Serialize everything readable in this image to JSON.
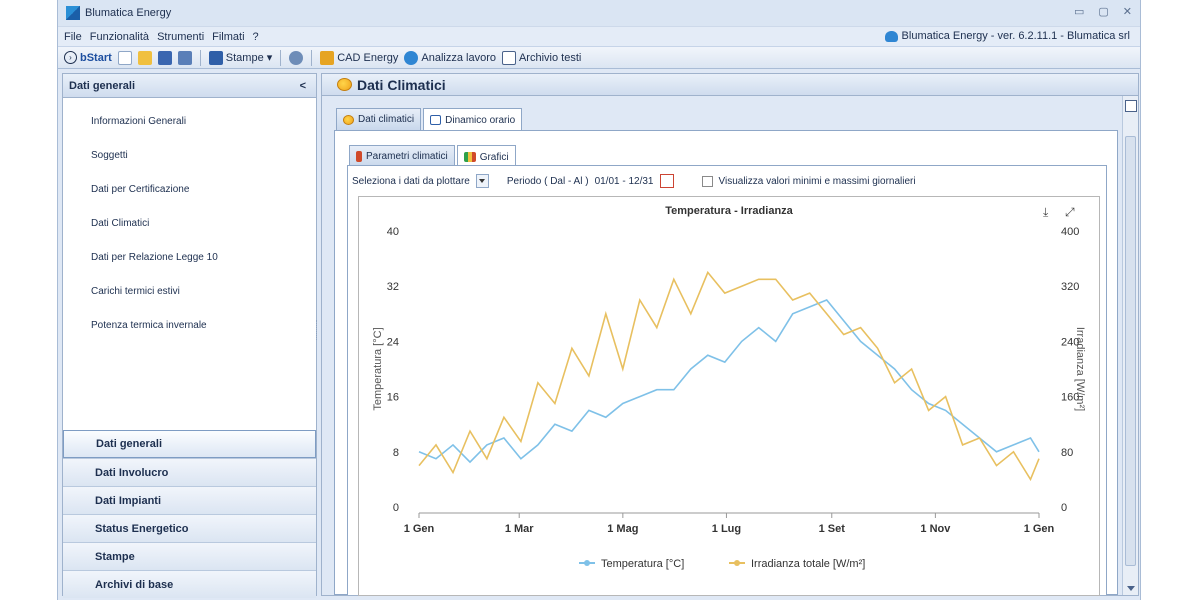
{
  "window": {
    "title": "Blumatica Energy",
    "controls": [
      "▭",
      "▢",
      "✕"
    ]
  },
  "menu": {
    "items": [
      "File",
      "Funzionalità",
      "Strumenti",
      "Filmati",
      "?"
    ],
    "version": "Blumatica Energy - ver. 6.2.11.1 - Blumatica srl"
  },
  "toolbar": {
    "bstart": "bStart",
    "stampe": "Stampe",
    "cad": "CAD Energy",
    "analizza": "Analizza lavoro",
    "archivio": "Archivio testi"
  },
  "left": {
    "header": "Dati generali",
    "collapse": "<",
    "items": [
      {
        "label": "Informazioni Generali",
        "color": "#2f7fd0"
      },
      {
        "label": "Soggetti",
        "color": "#c0392b"
      },
      {
        "label": "Dati per Certificazione",
        "color": "#2563b8"
      },
      {
        "label": "Dati Climatici",
        "color": "#f0a21a"
      },
      {
        "label": "Dati per Relazione Legge 10",
        "color": "#2563b8"
      },
      {
        "label": "Carichi termici estivi",
        "color": "#e0a010"
      },
      {
        "label": "Potenza termica invernale",
        "color": "#3a8fd8"
      }
    ],
    "nav": [
      {
        "label": "Dati generali",
        "color": "#6d7d93"
      },
      {
        "label": "Dati Involucro",
        "color": "#2f7fd0"
      },
      {
        "label": "Dati Impianti",
        "color": "#2f7fd0"
      },
      {
        "label": "Status Energetico",
        "color": "#2fa14a"
      },
      {
        "label": "Stampe",
        "color": "#7a8aa0"
      },
      {
        "label": "Archivi di base",
        "color": "#e0b040"
      }
    ]
  },
  "main": {
    "title": "Dati Climatici",
    "tabs": [
      "Dati climatici",
      "Dinamico orario"
    ],
    "subtabs": [
      "Parametri climatici",
      "Grafici"
    ],
    "filter": {
      "select_label": "Seleziona i dati da plottare",
      "period_label": "Periodo ( Dal - Al )",
      "period_value": "01/01 - 12/31",
      "minmax_label": "Visualizza valori minimi e massimi giornalieri"
    }
  },
  "chart_data": {
    "type": "line",
    "title": "Temperatura - Irradianza",
    "xlabel": "",
    "ylabel": "Temperatura [°C]",
    "y2label": "Irradianza [W/m²]",
    "xticks": [
      "1 Gen",
      "1 Mar",
      "1 Mag",
      "1 Lug",
      "1 Set",
      "1 Nov",
      "1 Gen"
    ],
    "xtick_days": [
      0,
      59,
      120,
      181,
      243,
      304,
      365
    ],
    "ylim": [
      0,
      40
    ],
    "yticks": [
      0,
      8,
      16,
      24,
      32,
      40
    ],
    "y2lim": [
      0,
      400
    ],
    "y2ticks": [
      0,
      80,
      160,
      240,
      320,
      400
    ],
    "legend": "bottom",
    "series": [
      {
        "name": "Temperatura [°C]",
        "axis": "left",
        "color": "#7fc1e8",
        "x": [
          0,
          10,
          20,
          30,
          40,
          50,
          60,
          70,
          80,
          90,
          100,
          110,
          120,
          130,
          140,
          150,
          160,
          170,
          180,
          190,
          200,
          210,
          220,
          230,
          240,
          250,
          260,
          270,
          280,
          290,
          300,
          310,
          320,
          330,
          340,
          350,
          360,
          365
        ],
        "values": [
          8,
          7,
          9,
          6.5,
          9,
          10,
          7,
          9,
          12,
          11,
          14,
          13,
          15,
          16,
          17,
          17,
          20,
          22,
          21,
          24,
          26,
          24,
          28,
          29,
          30,
          27,
          24,
          22,
          20,
          17,
          15,
          14,
          12,
          10,
          8,
          9,
          10,
          8
        ]
      },
      {
        "name": "Irradianza totale [W/m²]",
        "axis": "right",
        "color": "#e8c060",
        "x": [
          0,
          10,
          20,
          30,
          40,
          50,
          60,
          70,
          80,
          90,
          100,
          110,
          120,
          130,
          140,
          150,
          160,
          170,
          180,
          190,
          200,
          210,
          220,
          230,
          240,
          250,
          260,
          270,
          280,
          290,
          300,
          310,
          320,
          330,
          340,
          350,
          360,
          365
        ],
        "values": [
          60,
          90,
          50,
          110,
          70,
          130,
          95,
          180,
          150,
          230,
          190,
          280,
          200,
          300,
          260,
          330,
          280,
          340,
          310,
          320,
          330,
          330,
          300,
          310,
          280,
          250,
          260,
          230,
          180,
          200,
          140,
          160,
          90,
          100,
          60,
          80,
          40,
          70
        ]
      }
    ]
  }
}
